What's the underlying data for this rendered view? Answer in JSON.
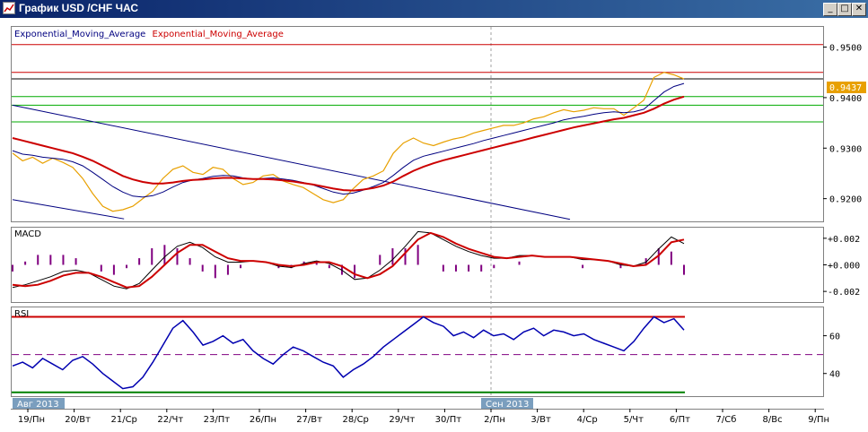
{
  "window": {
    "title": "График USD /CHF ЧАС",
    "buttons": {
      "minimize": "_",
      "maximize": "□",
      "close": "✕"
    },
    "icon": "chart-window-icon"
  },
  "chart_data": [
    {
      "type": "line",
      "panel": "price",
      "legend": [
        "Exponential_Moving_Average",
        "Exponential_Moving_Average"
      ],
      "ylim": [
        0.9155,
        0.954
      ],
      "yticks": [
        "0.9500",
        "0.9400",
        "0.9300",
        "0.9200"
      ],
      "current_price": "0.9437",
      "hlines": [
        {
          "value": 0.9505,
          "color": "#cc0000"
        },
        {
          "value": 0.945,
          "color": "#cc0000"
        },
        {
          "value": 0.9437,
          "color": "#000000"
        },
        {
          "value": 0.9402,
          "color": "#00aa00"
        },
        {
          "value": 0.9385,
          "color": "#00aa00"
        },
        {
          "value": 0.9352,
          "color": "#00aa00"
        }
      ],
      "channel": [
        {
          "x1": "19/Пн",
          "y1": 0.9385,
          "x2": "1/Вс",
          "y2": 0.9159
        },
        {
          "x1": "19/Пн",
          "y1": 0.9198,
          "x2": "21/Ср",
          "y2": 0.916
        }
      ],
      "series": [
        {
          "color": "#e8a000",
          "values": [
            0.929,
            0.9275,
            0.9282,
            0.927,
            0.928,
            0.9272,
            0.9262,
            0.924,
            0.921,
            0.9185,
            0.9175,
            0.9178,
            0.9185,
            0.92,
            0.9215,
            0.924,
            0.9258,
            0.9265,
            0.9252,
            0.9248,
            0.9262,
            0.9258,
            0.924,
            0.9228,
            0.9232,
            0.9245,
            0.9248,
            0.9235,
            0.9228,
            0.9222,
            0.921,
            0.9198,
            0.9192,
            0.9198,
            0.922,
            0.9238,
            0.9245,
            0.9255,
            0.929,
            0.931,
            0.932,
            0.931,
            0.9305,
            0.9312,
            0.9318,
            0.9322,
            0.933,
            0.9335,
            0.934,
            0.9345,
            0.9345,
            0.935,
            0.9358,
            0.9362,
            0.937,
            0.9376,
            0.9372,
            0.9375,
            0.938,
            0.9378,
            0.9378,
            0.9365,
            0.938,
            0.9395,
            0.944,
            0.945,
            0.9445,
            0.9437
          ]
        },
        {
          "color": "#000080",
          "values": [
            0.9295,
            0.9288,
            0.9286,
            0.9282,
            0.928,
            0.9278,
            0.9273,
            0.9265,
            0.9252,
            0.9238,
            0.9224,
            0.9213,
            0.9205,
            0.9203,
            0.9206,
            0.9213,
            0.9223,
            0.9232,
            0.9237,
            0.924,
            0.9244,
            0.9246,
            0.9245,
            0.9241,
            0.9239,
            0.924,
            0.9241,
            0.9239,
            0.9236,
            0.9232,
            0.9227,
            0.922,
            0.9213,
            0.9209,
            0.9211,
            0.9217,
            0.9224,
            0.9232,
            0.9246,
            0.9262,
            0.9276,
            0.9284,
            0.9289,
            0.9294,
            0.9299,
            0.9304,
            0.9309,
            0.9315,
            0.932,
            0.9325,
            0.933,
            0.9335,
            0.934,
            0.9345,
            0.935,
            0.9356,
            0.936,
            0.9363,
            0.9367,
            0.937,
            0.9372,
            0.937,
            0.9372,
            0.9377,
            0.9394,
            0.9411,
            0.9422,
            0.9428
          ]
        },
        {
          "color": "#cc0000",
          "values": [
            0.932,
            0.9315,
            0.931,
            0.9305,
            0.93,
            0.9295,
            0.929,
            0.9283,
            0.9275,
            0.9265,
            0.9255,
            0.9245,
            0.9238,
            0.9233,
            0.923,
            0.923,
            0.9232,
            0.9235,
            0.9237,
            0.9238,
            0.924,
            0.9241,
            0.9241,
            0.924,
            0.9239,
            0.9239,
            0.9238,
            0.9236,
            0.9234,
            0.9231,
            0.9228,
            0.9224,
            0.922,
            0.9217,
            0.9216,
            0.9218,
            0.9221,
            0.9226,
            0.9234,
            0.9245,
            0.9255,
            0.9263,
            0.927,
            0.9276,
            0.9281,
            0.9286,
            0.9291,
            0.9296,
            0.9301,
            0.9306,
            0.9311,
            0.9316,
            0.9321,
            0.9326,
            0.9331,
            0.9336,
            0.9341,
            0.9345,
            0.9349,
            0.9353,
            0.9357,
            0.936,
            0.9365,
            0.937,
            0.9378,
            0.9388,
            0.9396,
            0.9402
          ]
        }
      ]
    },
    {
      "type": "line",
      "panel": "macd",
      "title": "MACD",
      "ylim": [
        -0.0028,
        0.0028
      ],
      "yticks": [
        "+0.002",
        "+0.000",
        "-0.002"
      ],
      "series": [
        {
          "color": "#000000",
          "values": [
            -0.0017,
            -0.0015,
            -0.0012,
            -0.0009,
            -0.0005,
            -0.0004,
            -0.0006,
            -0.0011,
            -0.0016,
            -0.0018,
            -0.0014,
            -0.0004,
            0.0006,
            0.0014,
            0.0017,
            0.0013,
            0.0006,
            0.0002,
            0.0002,
            0.0003,
            0.0002,
            -0.0001,
            -0.0002,
            0.0001,
            0.0003,
            0.0001,
            -0.0004,
            -0.0011,
            -0.001,
            -0.0004,
            0.0004,
            0.0014,
            0.0025,
            0.0024,
            0.0019,
            0.0014,
            0.001,
            0.0007,
            0.0005,
            0.0005,
            0.0007,
            0.0007,
            0.0006,
            0.0006,
            0.0006,
            0.0004,
            0.0004,
            0.0003,
            0.0,
            -0.0001,
            0.0002,
            0.0012,
            0.0021,
            0.0016
          ]
        },
        {
          "color": "#cc0000",
          "values": [
            -0.0015,
            -0.0016,
            -0.0015,
            -0.0012,
            -0.0008,
            -0.0006,
            -0.0006,
            -0.0009,
            -0.0013,
            -0.0017,
            -0.0016,
            -0.0009,
            0.0,
            0.0009,
            0.0015,
            0.0015,
            0.001,
            0.0005,
            0.0003,
            0.0003,
            0.0002,
            0.0,
            -0.0001,
            0.0,
            0.0002,
            0.0002,
            -0.0001,
            -0.0007,
            -0.001,
            -0.0007,
            -0.0001,
            0.0009,
            0.0019,
            0.0024,
            0.0021,
            0.0016,
            0.0012,
            0.0009,
            0.0006,
            0.0005,
            0.0006,
            0.0007,
            0.0006,
            0.0006,
            0.0006,
            0.0005,
            0.0004,
            0.0003,
            0.0001,
            -0.0001,
            0.0,
            0.0007,
            0.0017,
            0.0019
          ]
        }
      ]
    },
    {
      "type": "line",
      "panel": "rsi",
      "title": "RSI",
      "ylim": [
        28,
        75
      ],
      "yticks": [
        "60",
        "40"
      ],
      "hlines": [
        {
          "value": 70,
          "color": "#cc0000"
        },
        {
          "value": 50,
          "color": "#800080",
          "dashed": true
        },
        {
          "value": 30,
          "color": "#008000"
        }
      ],
      "series": [
        {
          "color": "#0000b0",
          "values": [
            44,
            46,
            43,
            48,
            45,
            42,
            47,
            49,
            45,
            40,
            36,
            32,
            33,
            38,
            46,
            55,
            64,
            68,
            62,
            55,
            57,
            60,
            56,
            58,
            52,
            48,
            45,
            50,
            54,
            52,
            49,
            46,
            44,
            38,
            42,
            45,
            49,
            54,
            58,
            62,
            66,
            70,
            67,
            65,
            60,
            62,
            59,
            63,
            60,
            61,
            58,
            62,
            64,
            60,
            63,
            62,
            60,
            61,
            58,
            56,
            54,
            52,
            57,
            64,
            70,
            67,
            69,
            63
          ]
        }
      ]
    }
  ],
  "x_labels": [
    "19/Пн",
    "20/Вт",
    "21/Ср",
    "22/Чт",
    "23/Пт",
    "26/Пн",
    "27/Вт",
    "28/Ср",
    "29/Чт",
    "30/Пт",
    "2/Пн",
    "3/Вт",
    "4/Ср",
    "5/Чт",
    "6/Пт",
    "7/Сб",
    "8/Вс",
    "9/Пн"
  ],
  "month_labels": [
    "Авг 2013",
    "Сен 2013"
  ]
}
